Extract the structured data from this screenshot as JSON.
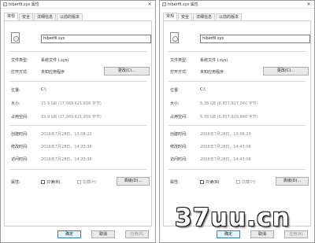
{
  "windows": [
    {
      "title": "hiberfil.sys 属性",
      "tabs": [
        "常规",
        "安全",
        "详细信息",
        "以前的版本"
      ],
      "file_name": "hiberfil.sys",
      "type_label": "文件类型:",
      "type_value": "系统文件 (.sys)",
      "open_label": "打开方式:",
      "open_value": "未知应用程序",
      "change_button": "更改(C)...",
      "location_label": "位置:",
      "location_value": "C:\\",
      "size_label": "大小:",
      "size_value": "15.9 GB (17,069,621,656 字节)",
      "disk_size_label": "占用空间:",
      "disk_size_value": "15.9 GB (17,069,621,656 字节)",
      "created_label": "创建时间:",
      "created_value": "2016年7月28日，13:08:23",
      "modified_label": "修改时间:",
      "modified_value": "2016年7月28日，14:23:38",
      "accessed_label": "访问时间:",
      "accessed_value": "2016年7月28日，14:23:38",
      "attrs_label": "属性:",
      "readonly_label": "只读(R)",
      "hidden_label": "隐藏(H)",
      "advanced_button": "高级(D)...",
      "ok_button": "确定",
      "cancel_button": "取消",
      "apply_button": "应用(A)"
    },
    {
      "title": "hiberfil.sys 属性",
      "tabs": [
        "常规",
        "安全",
        "详细信息",
        "以前的版本"
      ],
      "file_name": "hiberfil.sys",
      "type_label": "文件类型:",
      "type_value": "系统文件 (.sys)",
      "open_label": "打开方式:",
      "open_value": "未知应用程序",
      "change_button": "更改(C)...",
      "location_label": "位置:",
      "location_value": "C:\\",
      "size_label": "大小:",
      "size_value": "6.38 GB (6,857,927,040 字节)",
      "disk_size_label": "占用空间:",
      "disk_size_value": "6.38 GB (6,857,929,840 字节)",
      "created_label": "创建时间:",
      "created_value": "2016年7月28日，13:08:23",
      "modified_label": "修改时间:",
      "modified_value": "2016年7月28日，14:43:08",
      "accessed_label": "访问时间:",
      "accessed_value": "2016年7月28日，14:43:08",
      "attrs_label": "属性:",
      "readonly_label": "只读(R)",
      "hidden_label": "隐藏(H)",
      "advanced_button": "高级(D)...",
      "ok_button": "确定",
      "cancel_button": "取消",
      "apply_button": "应用(A)"
    }
  ],
  "watermark": "37uu.cn",
  "colors": {
    "ok_button_border": "#3c7fb1",
    "disabled_text": "#999999"
  }
}
